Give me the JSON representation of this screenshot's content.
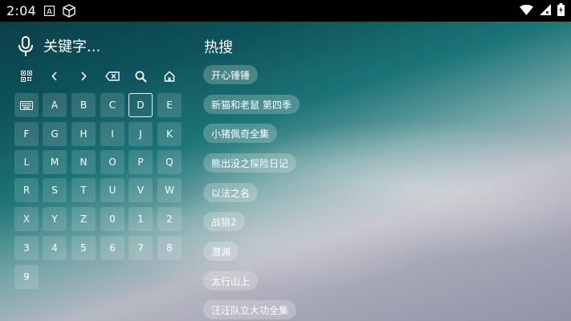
{
  "status_bar": {
    "time": "2:04",
    "icons": [
      "notification-a-icon",
      "cube-icon",
      "wifi-icon",
      "cellular-signal-icon",
      "battery-icon"
    ]
  },
  "search": {
    "query": "关键字..."
  },
  "keyboard": {
    "tools": [
      "qr-code-icon",
      "chevron-left-icon",
      "chevron-right-icon",
      "backspace-icon",
      "search-icon",
      "home-icon"
    ],
    "toggle_icon": "keyboard-icon",
    "keys": [
      "A",
      "B",
      "C",
      "D",
      "E",
      "F",
      "G",
      "H",
      "I",
      "J",
      "K",
      "L",
      "M",
      "N",
      "O",
      "P",
      "Q",
      "R",
      "S",
      "T",
      "U",
      "V",
      "W",
      "X",
      "Y",
      "Z",
      "0",
      "1",
      "2",
      "3",
      "4",
      "5",
      "6",
      "7",
      "8",
      "9"
    ],
    "focused_key": "D"
  },
  "hot": {
    "title": "热搜",
    "items": [
      "开心锤锤",
      "新猫和老鼠 第四季",
      "小猪佩奇全集",
      "熊出没之探险日记",
      "以法之名",
      "战狼2",
      "潜渊",
      "太行山上",
      "汪汪队立大功全集"
    ]
  }
}
